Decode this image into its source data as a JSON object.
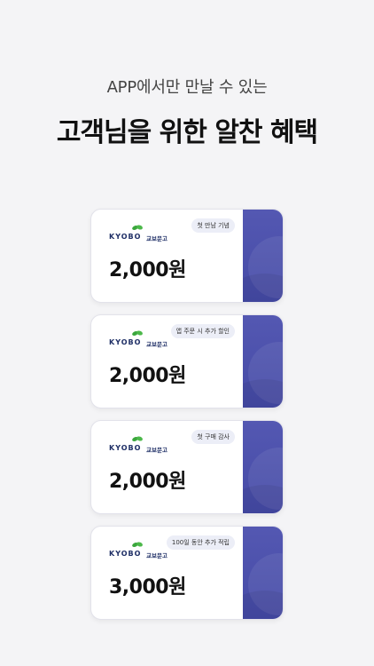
{
  "header": {
    "subtitle": "APP에서만 만날 수 있는",
    "title": "고객님을 위한 알찬 혜택"
  },
  "brand": {
    "name_en": "KYOBO",
    "name_ko": "교보문고",
    "leaf_color": "#3aa63c",
    "stub_color": "#4b50ad"
  },
  "coupons": [
    {
      "tag": "첫 만남 기념",
      "amount": "2,000원"
    },
    {
      "tag": "앱 주문 시 추가 할인",
      "amount": "2,000원"
    },
    {
      "tag": "첫 구매 감사",
      "amount": "2,000원"
    },
    {
      "tag": "100일 동안 추가 적립",
      "amount": "3,000원"
    }
  ]
}
